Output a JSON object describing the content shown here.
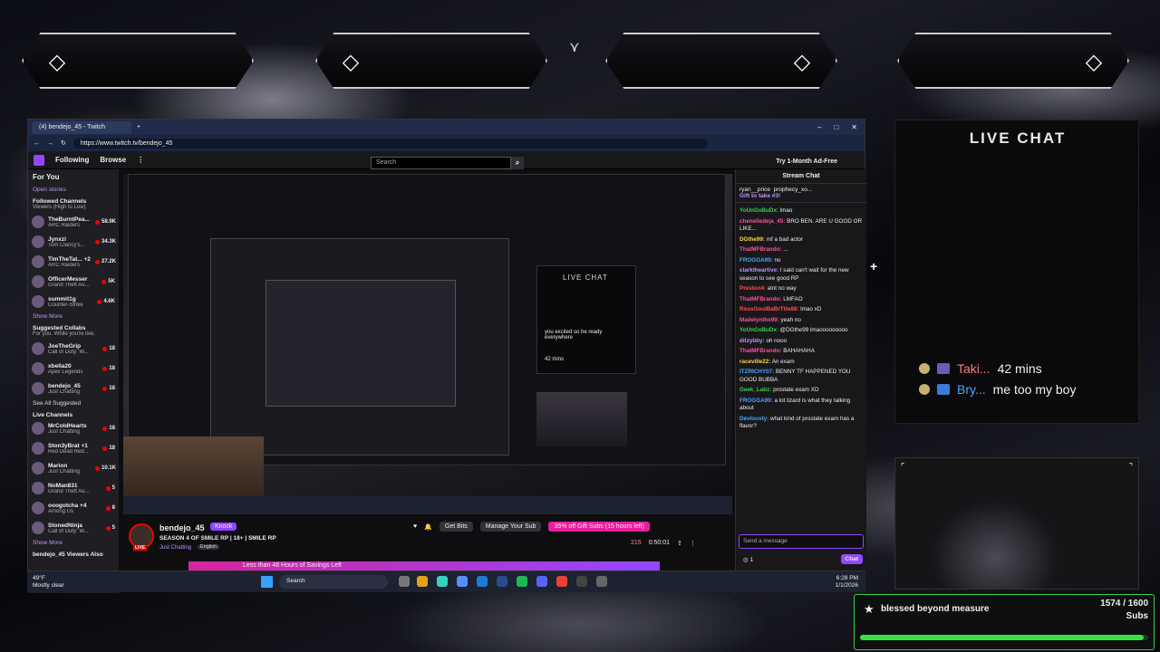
{
  "browser": {
    "tab_title": "(4) bendejo_45 - Twitch",
    "url": "https://www.twitch.tv/bendejo_45"
  },
  "twitch_nav": {
    "following": "Following",
    "browse": "Browse",
    "search_placeholder": "Search",
    "ad_free": "Try 1-Month Ad-Free"
  },
  "sidebar": {
    "for_you": "For You",
    "open_stories": "Open stories",
    "followed_title": "Followed Channels",
    "followed_sub": "Viewers (High to Low)",
    "followed": [
      {
        "name": "TheBurntPea...",
        "game": "ARC Raiders",
        "viewers": "58.9K"
      },
      {
        "name": "Jynxzi",
        "game": "Tom Clancy's...",
        "viewers": "34.3K"
      },
      {
        "name": "TimTheTat... +2",
        "game": "ARC Raiders",
        "viewers": "27.2K"
      },
      {
        "name": "OfficerMesser",
        "game": "Grand Theft Au...",
        "viewers": "5K"
      },
      {
        "name": "summit1g",
        "game": "Counter-Strike",
        "viewers": "4.6K"
      }
    ],
    "show_more": "Show More",
    "suggested_title": "Suggested Collabs",
    "suggested_sub": "For you. While you're live.",
    "suggested": [
      {
        "name": "JoeTheGrip",
        "game": "Call of Duty: W...",
        "viewers": "18"
      },
      {
        "name": "xbella20",
        "game": "Apex Legends",
        "viewers": "18"
      },
      {
        "name": "bendejo_45",
        "game": "Just Chatting",
        "viewers": "18"
      }
    ],
    "see_all": "See All Suggested",
    "live_title": "Live Channels",
    "live": [
      {
        "name": "MrColdHearts",
        "game": "Just Chatting",
        "viewers": "18"
      },
      {
        "name": "Ston3yBrat +1",
        "game": "Red Dead Red...",
        "viewers": "18"
      },
      {
        "name": "Marion",
        "game": "Just Chatting",
        "viewers": "10.1K"
      },
      {
        "name": "NoMan831",
        "game": "Grand Theft Au...",
        "viewers": "5"
      },
      {
        "name": "ooogotcha +4",
        "game": "Among Us",
        "viewers": "8"
      },
      {
        "name": "StonedNinja",
        "game": "Call of Duty: W...",
        "viewers": "5"
      }
    ],
    "show_more2": "Show More",
    "viewers_also": "bendejo_45 Viewers Also"
  },
  "nested_overlay": {
    "live_chat": "LIVE CHAT",
    "m1": "you excited so he ready everywhere",
    "m2": "42 mins"
  },
  "stream": {
    "name": "bendejo_45",
    "knock": "Knock",
    "title": "SEASON 4 OF SMILE RP | 18+ | SMILE RP",
    "game": "Just Chatting",
    "tag": "English",
    "live": "LIVE",
    "get_bits": "Get Bits",
    "manage_sub": "Manage Your Sub",
    "gift_subs": "35% off Gift Subs (15 hours left)",
    "viewers": "215",
    "uptime": "0:50:01",
    "banner": "Less than 48 Hours of Savings Left"
  },
  "chat": {
    "title": "Stream Chat",
    "pinned_user": "ryan__price",
    "pinned_user2": "prophecy_xo...",
    "gift": "Gift to take #3!",
    "messages": [
      {
        "user": "YoUnGxBuDx:",
        "text": "lmao",
        "color": "#3ad04a"
      },
      {
        "user": "chenelledeja_45:",
        "text": "BRO BEN. ARE U GOOD OR LIKE...",
        "color": "#ff4f9a"
      },
      {
        "user": "DGthe99:",
        "text": "mf a bad actor",
        "color": "#ffd24a"
      },
      {
        "user": "ThatMFBrando:",
        "text": "...",
        "color": "#ff4f9a"
      },
      {
        "user": "FROGGA99:",
        "text": "no",
        "color": "#4aa4ff"
      },
      {
        "user": "clarktheartive:",
        "text": "I said can't wait for the new season to see good RP",
        "color": "#bf94ff"
      },
      {
        "user": "Preston4:",
        "text": "aint no way",
        "color": "#ff4f4f"
      },
      {
        "user": "ThatMFBrando:",
        "text": "LMFAO",
        "color": "#ff4f9a"
      },
      {
        "user": "RossGoulBaBrTtte88:",
        "text": "lmao xD",
        "color": "#ff4f4f"
      },
      {
        "user": "Madelynthe99:",
        "text": "yeah no",
        "color": "#ff4f9a"
      },
      {
        "user": "YoUnGxBuDx:",
        "text": "@DGthe99 lmaooooooooo",
        "color": "#3ad04a"
      },
      {
        "user": "ditzybby:",
        "text": "oh nooo",
        "color": "#bf94ff"
      },
      {
        "user": "ThatMFBrando:",
        "text": "BAHAHAHA",
        "color": "#ff4f9a"
      },
      {
        "user": "raceville22:",
        "text": "An exam",
        "color": "#ffd24a"
      },
      {
        "user": "ITZRICHY07:",
        "text": "BENNY TF HAPPENED YOU GOOD BUBBA",
        "color": "#4aa4ff"
      },
      {
        "user": "Geek_Labz:",
        "text": "prostate exam XD",
        "color": "#3ad04a"
      },
      {
        "user": "FROGGA99:",
        "text": "a lot lizard is what they talking about",
        "color": "#4aa4ff"
      },
      {
        "user": "Devlousty:",
        "text": "what kind of prostate exam has a flavor?",
        "color": "#4aa4ff"
      }
    ],
    "input_placeholder": "Send a message",
    "points": "1",
    "chat_button": "Chat"
  },
  "taskbar": {
    "temp": "49°F",
    "weather": "Mostly clear",
    "search": "Search",
    "time": "6:28 PM",
    "date": "1/1/2026"
  },
  "live_chat_overlay": {
    "title": "LIVE CHAT",
    "messages": [
      {
        "user": "Taki...",
        "text": "42 mins"
      },
      {
        "user": "Bry...",
        "text": "me too my boy"
      }
    ]
  },
  "sub_goal": {
    "label": "blessed beyond measure",
    "count": "1574 / 1600",
    "unit": "Subs",
    "progress": 0.98375
  },
  "colors": {
    "twitch_purple": "#9147ff",
    "live_red": "#eb0400",
    "goal_green": "#37e33f"
  }
}
